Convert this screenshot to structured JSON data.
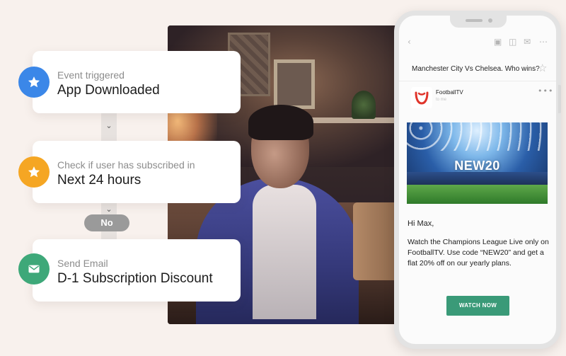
{
  "workflow": {
    "steps": [
      {
        "subtitle": "Event triggered",
        "title": "App Downloaded",
        "icon": "star-icon",
        "color": "#3b87e8"
      },
      {
        "subtitle": "Check if user has subscribed in",
        "title": "Next 24 hours",
        "icon": "star-icon",
        "color": "#f5a623"
      },
      {
        "subtitle": "Send Email",
        "title": "D-1 Subscription Discount",
        "icon": "email-icon",
        "color": "#3ea879"
      }
    ],
    "branch_label": "No"
  },
  "email": {
    "subject": "Manchester City Vs Chelsea. Who wins?",
    "sender_name": "FootballTV",
    "sender_to": "to me",
    "banner_code": "NEW20",
    "greeting": "Hi Max,",
    "body": "Watch the Champions League Live only on FootballTV. Use code “NEW20” and get a flat 20% off on our yearly plans.",
    "cta_label": "WATCH NOW",
    "accent_color": "#3a9a78",
    "brand_color": "#e0352b"
  },
  "toolbar_icons": [
    "back-icon",
    "archive-icon",
    "trash-icon",
    "mail-icon",
    "more-icon"
  ]
}
